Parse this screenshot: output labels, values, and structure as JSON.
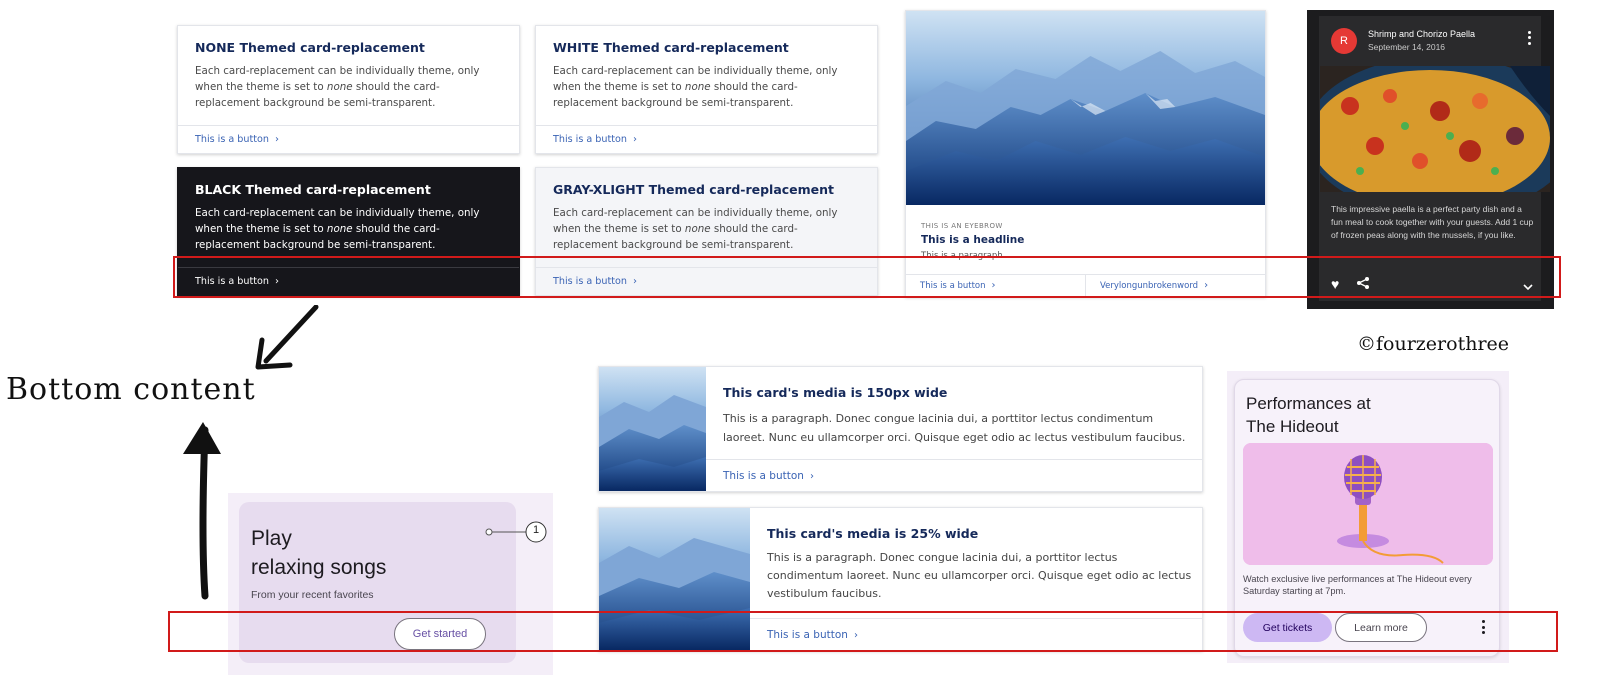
{
  "themed_cards": {
    "none": {
      "title": "NONE Themed card-replacement",
      "text_pre": "Each card-replacement can be individually theme, only when the theme is set to ",
      "text_em": "none",
      "text_post": " should the card-replacement background be semi-transparent.",
      "button": "This is a button"
    },
    "white": {
      "title": "WHITE Themed card-replacement",
      "text_pre": "Each card-replacement can be individually theme, only when the theme is set to ",
      "text_em": "none",
      "text_post": " should the card-replacement background be semi-transparent.",
      "button": "This is a button"
    },
    "black": {
      "title": "BLACK Themed card-replacement",
      "text_pre": "Each card-replacement can be individually theme, only when the theme is set to ",
      "text_em": "none",
      "text_post": " should the card-replacement background be semi-transparent.",
      "button": "This is a button"
    },
    "gray": {
      "title": "GRAY-XLIGHT Themed card-replacement",
      "text_pre": "Each card-replacement can be individually theme, only when the theme is set to ",
      "text_em": "none",
      "text_post": " should the card-replacement background be semi-transparent.",
      "button": "This is a button"
    }
  },
  "headline_card": {
    "eyebrow": "THIS IS AN EYEBROW",
    "headline": "This is a headline",
    "paragraph": "This is a paragraph.",
    "button_1": "This is a button",
    "button_2": "Verylongunbrokenword"
  },
  "recipe_card": {
    "avatar": "R",
    "title": "Shrimp and Chorizo Paella",
    "date": "September 14, 2016",
    "body": "This impressive paella is a perfect party dish and a fun meal to cook together with your guests. Add 1 cup of frozen peas along with the mussels, if you like."
  },
  "annotation": {
    "label": "Bottom content",
    "copyright": "©fourzerothree"
  },
  "media_card_1": {
    "title": "This card's media is 150px wide",
    "text": "This is a paragraph. Donec congue lacinia dui, a porttitor lectus condimentum laoreet. Nunc eu ullamcorper orci. Quisque eget odio ac lectus vestibulum faucibus.",
    "button": "This is a button"
  },
  "media_card_2": {
    "title": "This card's media is 25% wide",
    "text": "This is a paragraph. Donec congue lacinia dui, a porttitor lectus condimentum laoreet. Nunc eu ullamcorper orci. Quisque eget odio ac lectus vestibulum faucibus.",
    "button": "This is a button"
  },
  "play_card": {
    "title_line1": "Play",
    "title_line2": "relaxing songs",
    "subtitle": "From your recent favorites",
    "callout": "1",
    "button": "Get started"
  },
  "perf_card": {
    "title_line1": "Performances at",
    "title_line2": "The Hideout",
    "text": "Watch exclusive live performances at The Hideout every Saturday starting at 7pm.",
    "primary_button": "Get tickets",
    "secondary_button": "Learn more"
  },
  "icons": {
    "heart": "heart-icon",
    "share": "share-icon",
    "more": "more-vert-icon",
    "expand": "chevron-down-icon",
    "chevron": "chevron-right-icon"
  },
  "colors": {
    "highlight": "#d11a1a",
    "link": "#3a63b4",
    "title": "#15295a",
    "m3_purple": "#6750a4"
  }
}
